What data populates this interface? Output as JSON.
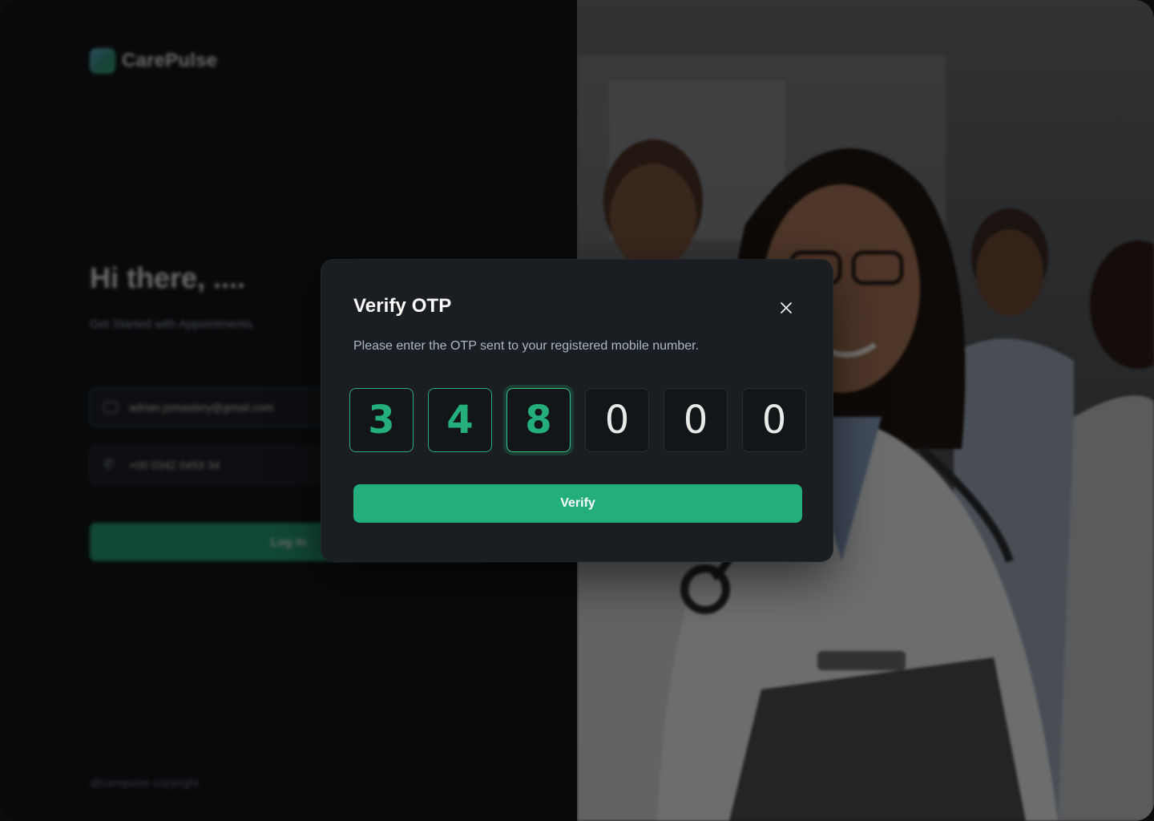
{
  "app": {
    "brand_name": "CarePulse",
    "brand_color": "#24ae7c"
  },
  "login": {
    "greeting": "Hi there, ....",
    "subtitle": "Get Started with Appointments.",
    "email_value": "adrian.jsmastery@gmail.com",
    "phone_value": "+00 0342 0453 34",
    "submit_label": "Log In",
    "copyright": "@carepulse copyright"
  },
  "otp_modal": {
    "title": "Verify OTP",
    "description": "Please enter the OTP sent to your registered mobile number.",
    "digits": [
      "3",
      "4",
      "8",
      "0",
      "0",
      "0"
    ],
    "verify_label": "Verify",
    "close_icon": "close-icon"
  }
}
